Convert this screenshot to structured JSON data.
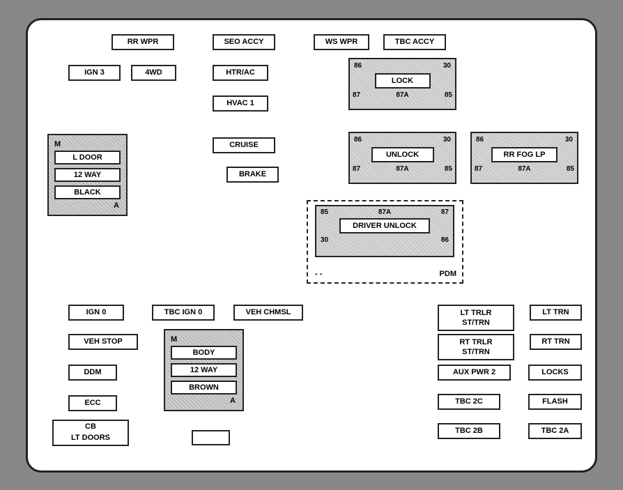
{
  "labels": {
    "rr_wpr": "RR WPR",
    "seo_accy": "SEO ACCY",
    "ws_wpr": "WS WPR",
    "tbc_accy": "TBC ACCY",
    "ign3": "IGN 3",
    "four_wd": "4WD",
    "htr_ac": "HTR/AC",
    "hvac1": "HVAC 1",
    "cruise": "CRUISE",
    "brake": "BRAKE",
    "ign0": "IGN 0",
    "tbc_ign0": "TBC IGN 0",
    "veh_chmsl": "VEH CHMSL",
    "veh_stop": "VEH STOP",
    "ddm": "DDM",
    "ecc": "ECC",
    "cb_lt_doors": "CB\nLT DOORS",
    "lt_trlr_st_trn": "LT TRLR\nST/TRN",
    "lt_trn": "LT TRN",
    "rt_trlr_st_trn": "RT TRLR\nST/TRN",
    "rt_trn": "RT TRN",
    "aux_pwr2": "AUX PWR 2",
    "locks": "LOCKS",
    "tbc_2c": "TBC 2C",
    "flash": "FLASH",
    "tbc_2b": "TBC 2B",
    "tbc_2a": "TBC 2A",
    "pdm": "PDM",
    "lock_relay": "LOCK",
    "unlock_relay": "UNLOCK",
    "rr_fog_lp": "RR FOG LP",
    "driver_unlock": "DRIVER UNLOCK",
    "l_door": "L DOOR",
    "twelve_way_top": "12 WAY",
    "black": "BLACK",
    "body": "BODY",
    "twelve_way_bot": "12 WAY",
    "brown": "BROWN",
    "m": "M",
    "a": "A"
  },
  "relay_nums": {
    "n86": "86",
    "n87a": "87A",
    "n87": "87",
    "n85": "85",
    "n30": "30"
  }
}
